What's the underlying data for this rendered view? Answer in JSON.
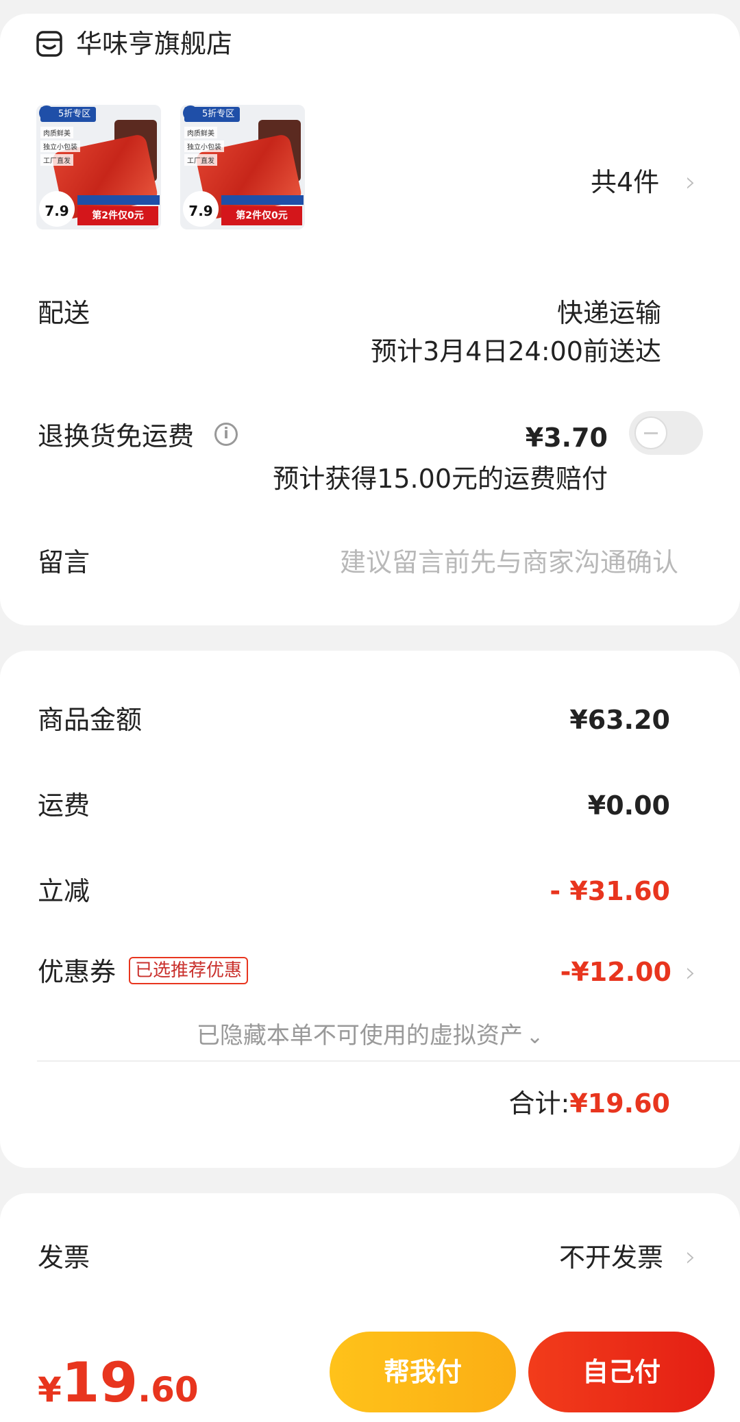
{
  "shop": {
    "name": "华味亨旗舰店",
    "icon": "shop-icon"
  },
  "products": [
    {
      "badge": "5折专区",
      "tags": [
        "肉质鲜美",
        "独立小包装",
        "工厂直发"
      ],
      "price_tag": "7.9",
      "promo": "第2件仅0元",
      "icon": "product-thumbnail"
    },
    {
      "badge": "5折专区",
      "tags": [
        "肉质鲜美",
        "独立小包装",
        "工厂直发"
      ],
      "price_tag": "7.9",
      "promo": "第2件仅0元",
      "icon": "product-thumbnail"
    }
  ],
  "items_count": {
    "prefix": "共",
    "count": "4",
    "suffix": "件"
  },
  "delivery": {
    "label": "配送",
    "method": "快递运输",
    "estimate": "预计3月4日24:00前送达"
  },
  "return_insurance": {
    "label": "退换货免运费",
    "price": "¥3.70",
    "note": "预计获得15.00元的运费赔付",
    "enabled": false
  },
  "message": {
    "label": "留言",
    "placeholder": "建议留言前先与商家沟通确认"
  },
  "amounts": {
    "goods_label": "商品金额",
    "goods_value": "¥63.20",
    "shipping_label": "运费",
    "shipping_value": "¥0.00",
    "discount_label": "立减",
    "discount_value": "- ¥31.60",
    "coupon_label": "优惠券",
    "coupon_tag": "已选推荐优惠",
    "coupon_value": "-¥12.00",
    "hidden_assets": "已隐藏本单不可使用的虚拟资产",
    "total_label": "合计:",
    "total_value": "¥19.60"
  },
  "invoice": {
    "label": "发票",
    "value": "不开发票"
  },
  "footer": {
    "currency": "¥",
    "price_int": "19",
    "price_dec": ".60",
    "help_pay": "帮我付",
    "self_pay": "自己付"
  },
  "colors": {
    "accent_red": "#e8351e",
    "help_yellow": "#fbb516",
    "pay_red": "#ea2a17"
  }
}
